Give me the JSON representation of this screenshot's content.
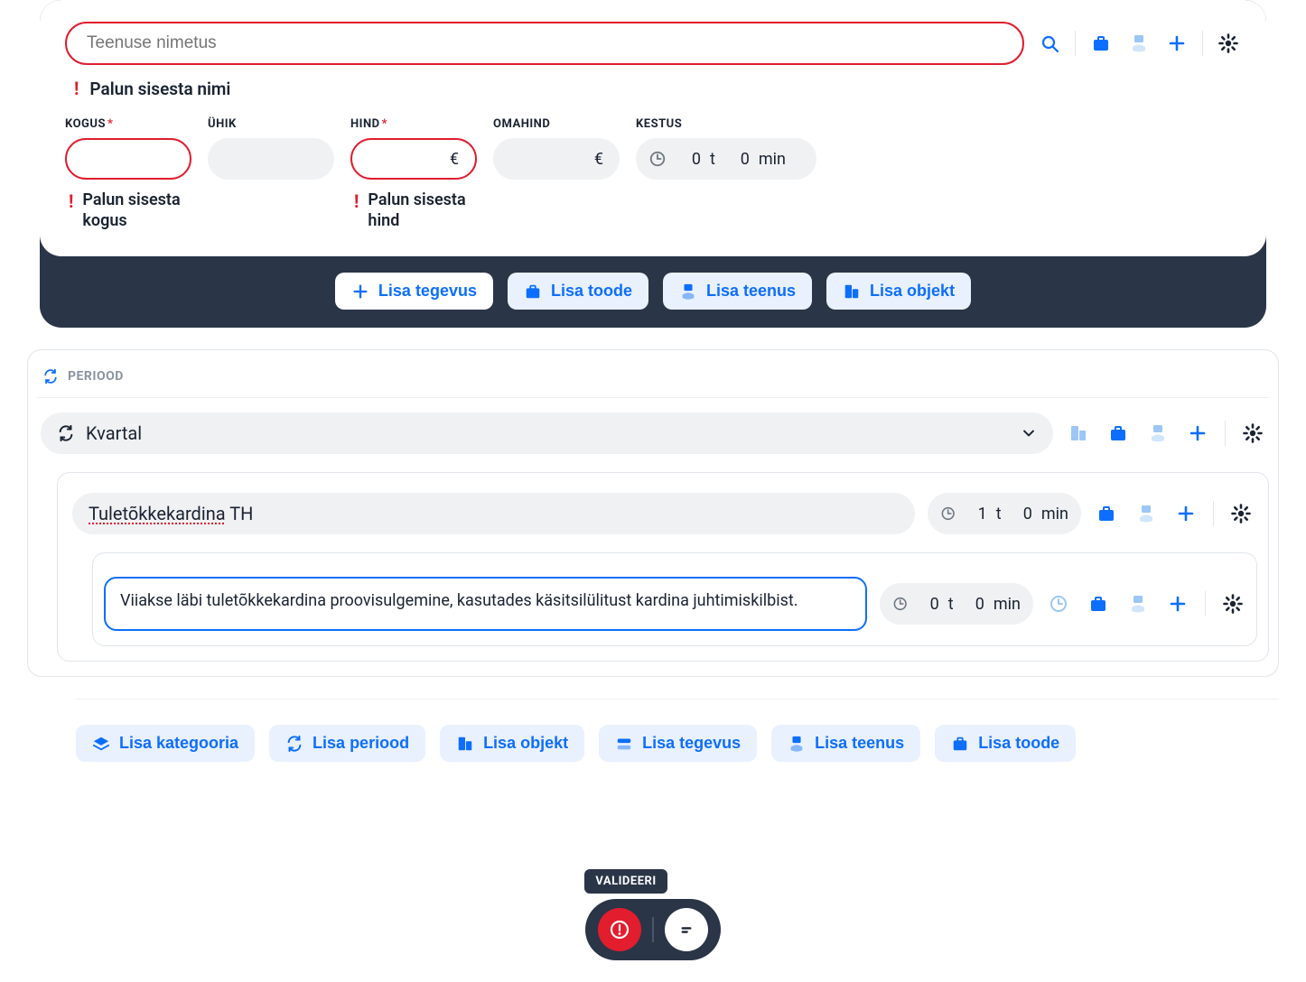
{
  "service": {
    "name_placeholder": "Teenuse nimetus",
    "name_error": "Palun sisesta nimi",
    "fields": {
      "kogus": {
        "label": "KOGUS",
        "required": true,
        "value": "",
        "error": "Palun sisesta kogus"
      },
      "uhik": {
        "label": "ÜHIK",
        "required": false,
        "value": ""
      },
      "hind": {
        "label": "HIND",
        "required": true,
        "value": "",
        "suffix": "€",
        "error": "Palun sisesta hind"
      },
      "omahind": {
        "label": "OMAHIND",
        "required": false,
        "value": "",
        "suffix": "€"
      },
      "kestus": {
        "label": "KESTUS",
        "hours": "0",
        "hours_unit": "t",
        "mins": "0",
        "mins_unit": "min"
      }
    }
  },
  "dark_actions": {
    "tegevus": "Lisa tegevus",
    "toode": "Lisa toode",
    "teenus": "Lisa teenus",
    "objekt": "Lisa objekt"
  },
  "period": {
    "header": "PERIOOD",
    "select_value": "Kvartal",
    "item": {
      "title_spell": "Tuletõkkekardina",
      "title_rest": " TH",
      "duration": {
        "hours": "1",
        "hours_unit": "t",
        "mins": "0",
        "mins_unit": "min"
      },
      "desc": {
        "text": "Viiakse läbi tuletõkkekardina proovisulgemine, kasutades käsitsilülitust kardina juhtimiskilbist.",
        "duration": {
          "hours": "0",
          "hours_unit": "t",
          "mins": "0",
          "mins_unit": "min"
        }
      }
    }
  },
  "footer": {
    "kategooria": "Lisa kategooria",
    "periood": "Lisa periood",
    "objekt": "Lisa objekt",
    "tegevus": "Lisa tegevus",
    "teenus": "Lisa teenus",
    "toode": "Lisa toode"
  },
  "float": {
    "tooltip": "VALIDEERI"
  }
}
